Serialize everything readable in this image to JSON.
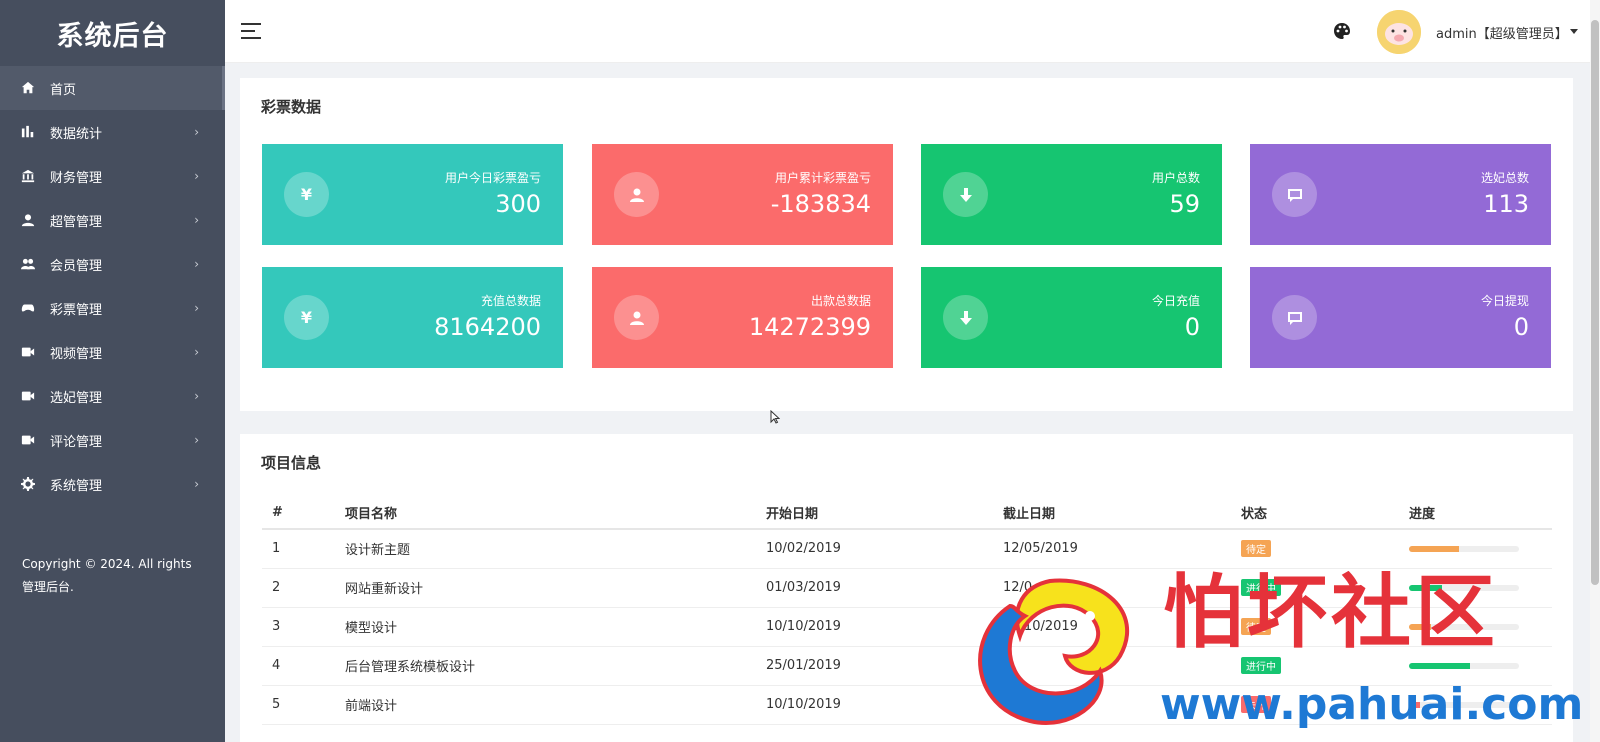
{
  "sidebar": {
    "brand": "系统后台",
    "items": [
      {
        "label": "首页",
        "icon": "home-icon"
      },
      {
        "label": "数据统计",
        "icon": "bar-chart-icon"
      },
      {
        "label": "财务管理",
        "icon": "bank-icon"
      },
      {
        "label": "超管管理",
        "icon": "user-icon"
      },
      {
        "label": "会员管理",
        "icon": "users-icon"
      },
      {
        "label": "彩票管理",
        "icon": "gamepad-icon"
      },
      {
        "label": "视频管理",
        "icon": "video-icon"
      },
      {
        "label": "选妃管理",
        "icon": "video-icon"
      },
      {
        "label": "评论管理",
        "icon": "video-icon"
      },
      {
        "label": "系统管理",
        "icon": "gear-icon"
      }
    ],
    "copyright": "Copyright © 2024. All rights 管理后台."
  },
  "header": {
    "user": "admin【超级管理员】",
    "icons": [
      "menu-icon",
      "palette-icon",
      "avatar",
      "caret-down-icon"
    ]
  },
  "lottery": {
    "title": "彩票数据",
    "stats": [
      {
        "label": "用户今日彩票盈亏",
        "value": "300",
        "color": "#34c8bb",
        "icon": "yen-icon"
      },
      {
        "label": "用户累计彩票盈亏",
        "value": "-183834",
        "color": "#fb6b6b",
        "icon": "user-icon"
      },
      {
        "label": "用户总数",
        "value": "59",
        "color": "#16c571",
        "icon": "download-icon"
      },
      {
        "label": "选妃总数",
        "value": "113",
        "color": "#936ad6",
        "icon": "comment-icon"
      },
      {
        "label": "充值总数据",
        "value": "8164200",
        "color": "#34c8bb",
        "icon": "yen-icon"
      },
      {
        "label": "出款总数据",
        "value": "14272399",
        "color": "#fb6b6b",
        "icon": "user-icon"
      },
      {
        "label": "今日充值",
        "value": "0",
        "color": "#16c571",
        "icon": "download-icon"
      },
      {
        "label": "今日提现",
        "value": "0",
        "color": "#936ad6",
        "icon": "comment-icon"
      }
    ]
  },
  "project": {
    "title": "项目信息",
    "columns": [
      "#",
      "项目名称",
      "开始日期",
      "截止日期",
      "状态",
      "进度"
    ],
    "rows": [
      {
        "no": "1",
        "name": "设计新主题",
        "start": "10/02/2019",
        "end": "12/05/2019",
        "status": "待定",
        "status_color": "#f5a454",
        "progress": 0.45,
        "progress_color": "#f5a454"
      },
      {
        "no": "2",
        "name": "网站重新设计",
        "start": "01/03/2019",
        "end": "12/0",
        "status": "进行中",
        "status_color": "#16c571",
        "progress": 0.3,
        "progress_color": "#16c571"
      },
      {
        "no": "3",
        "name": "模型设计",
        "start": "10/10/2019",
        "end": "10/10/2019",
        "status": "待定",
        "status_color": "#f5a454",
        "progress": 0.2,
        "progress_color": "#f5a454"
      },
      {
        "no": "4",
        "name": "后台管理系统模板设计",
        "start": "25/01/2019",
        "end": "",
        "status": "进行中",
        "status_color": "#16c571",
        "progress": 0.55,
        "progress_color": "#16c571"
      },
      {
        "no": "5",
        "name": "前端设计",
        "start": "10/10/2019",
        "end": "12/12/2019",
        "status": "未开",
        "status_color": "#fb6b6b",
        "progress": 0.1,
        "progress_color": "#fb6b6b"
      }
    ]
  },
  "watermark": {
    "title": "怕坏社区",
    "url": "www.pahuai.com"
  }
}
